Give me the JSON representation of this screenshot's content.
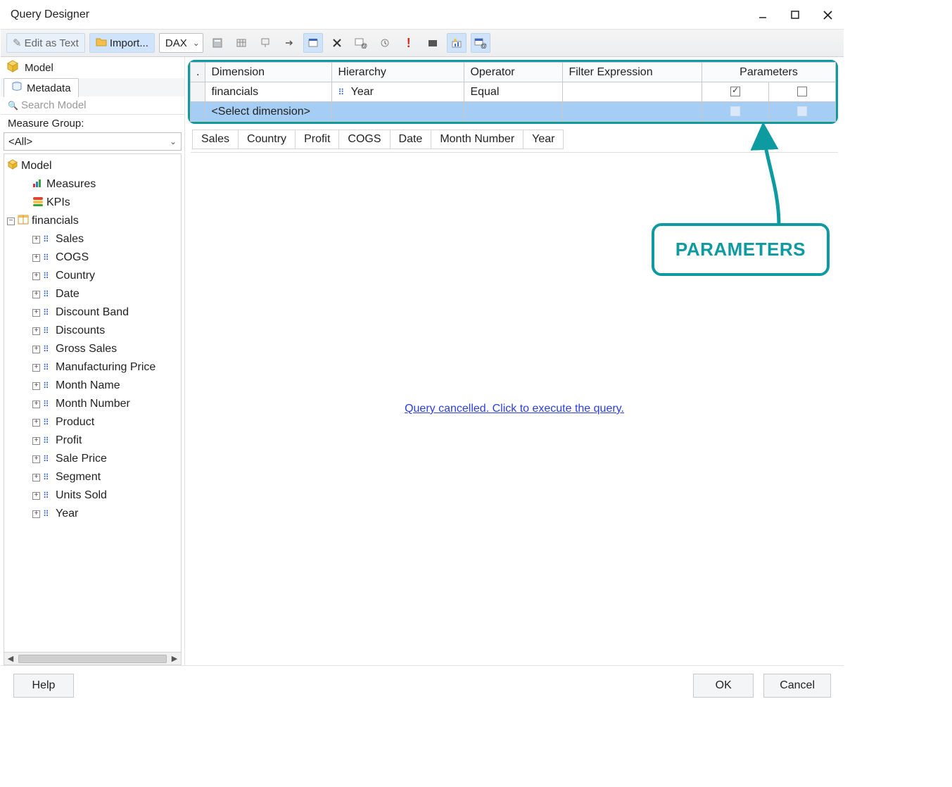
{
  "window": {
    "title": "Query Designer"
  },
  "toolbar": {
    "edit_as_text": "Edit as Text",
    "import": "Import...",
    "lang_select": "DAX"
  },
  "left": {
    "model_label": "Model",
    "metadata_tab": "Metadata",
    "search_placeholder": "Search Model",
    "measure_group_label": "Measure Group:",
    "measure_group_value": "<All>",
    "tree": {
      "root": "Model",
      "measures": "Measures",
      "kpis": "KPIs",
      "table": "financials",
      "cols": [
        "Sales",
        "COGS",
        "Country",
        "Date",
        "Discount Band",
        "Discounts",
        "Gross Sales",
        "Manufacturing Price",
        "Month Name",
        "Month Number",
        "Product",
        "Profit",
        "Sale Price",
        "Segment",
        "Units Sold",
        "Year"
      ]
    }
  },
  "filter": {
    "headers": {
      "dim": "Dimension",
      "hier": "Hierarchy",
      "op": "Operator",
      "expr": "Filter Expression",
      "params": "Parameters"
    },
    "row": {
      "dim": "financials",
      "hier": "Year",
      "op": "Equal"
    },
    "placeholder": "<Select dimension>"
  },
  "coltabs": [
    "Sales",
    "Country",
    "Profit",
    "COGS",
    "Date",
    "Month Number",
    "Year"
  ],
  "results": {
    "message": "Query cancelled. Click to execute the query."
  },
  "annotation": {
    "label": "PARAMETERS"
  },
  "footer": {
    "help": "Help",
    "ok": "OK",
    "cancel": "Cancel"
  }
}
